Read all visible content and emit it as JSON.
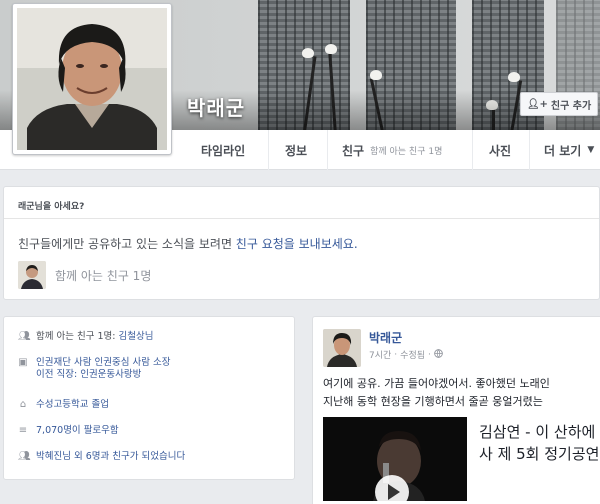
{
  "profile": {
    "name": "박래군",
    "add_friend_label": "친구 추가",
    "add_friend_icon": "add-person-icon"
  },
  "nav": {
    "timeline": "타임라인",
    "about": "정보",
    "friends": "친구",
    "friends_sub": "함께 아는 친구 1명",
    "photos": "사진",
    "more": "더 보기"
  },
  "know": {
    "title": "래군님을 아세요?",
    "message_prefix": "친구들에게만 공유하고 있는 소식을 보려면 ",
    "message_link": "친구 요청을 보내보세요.",
    "mutual": "함께 아는 친구 1명"
  },
  "intro": {
    "mutual_prefix": "함께 아는 친구 1명: ",
    "mutual_name": "김철상님",
    "work_line": "인권재단 사람 인권중심 사람 소장",
    "prev_job": "이전 직장: 인권운동사랑방",
    "school": "수성고등학교 졸업",
    "followers": "7,070명이 팔로우함",
    "friends_line": "박혜진님 외 6명과 친구가 되었습니다"
  },
  "post": {
    "author": "박래군",
    "time": "7시간",
    "separator": "·",
    "edited": "수정됨",
    "privacy_icon": "globe-icon",
    "text_line1": "여기에 공유. 가끔 들어야겠어서. 좋아했던 노래인",
    "text_line2": "지난해 동학 현장을 기행하면서 줄곧 웅얼거렸는",
    "link_title_line1": "김삼연 - 이 산하에",
    "link_title_line2": "사 제 5회 정기공연"
  }
}
